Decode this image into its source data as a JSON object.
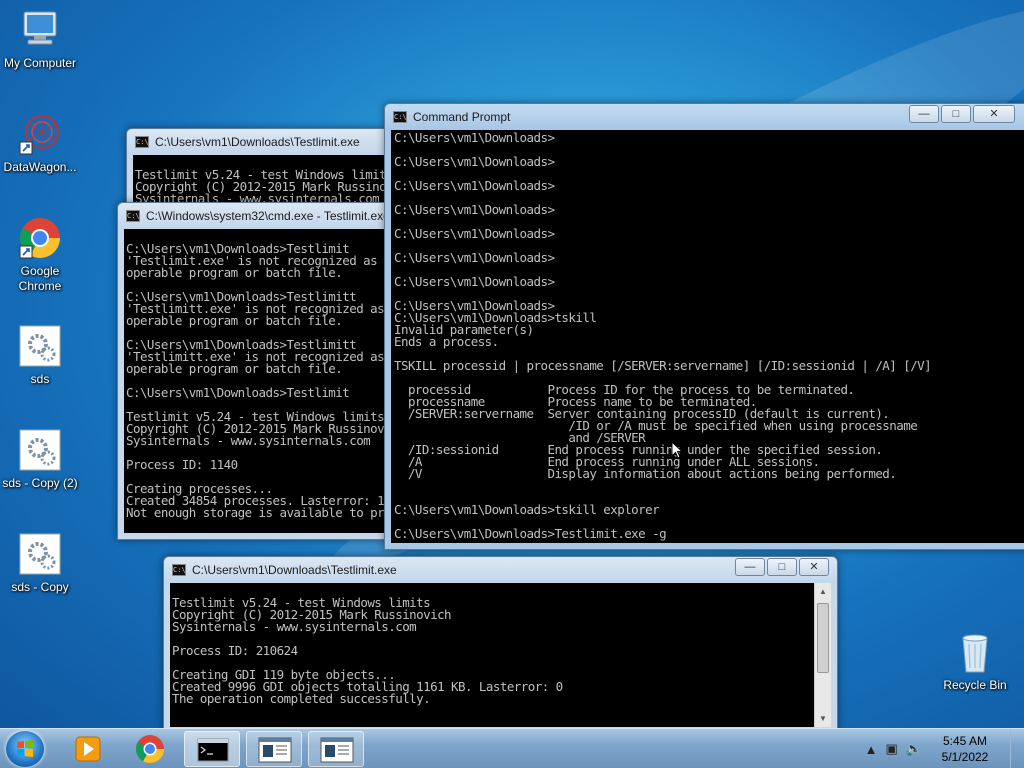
{
  "desktop_icons": [
    {
      "id": "my-computer",
      "label": "My Computer"
    },
    {
      "id": "datawagon",
      "label": "DataWagon..."
    },
    {
      "id": "chrome",
      "label": "Google Chrome"
    },
    {
      "id": "sds",
      "label": "sds"
    },
    {
      "id": "sds-copy-2",
      "label": "sds - Copy (2)"
    },
    {
      "id": "sds-copy",
      "label": "sds - Copy"
    },
    {
      "id": "recycle",
      "label": "Recycle Bin"
    }
  ],
  "windows": {
    "testlimit_back": {
      "title": "C:\\Users\\vm1\\Downloads\\Testlimit.exe",
      "content": "\nTestlimit v5.24 - test Windows limits\nCopyright (C) 2012-2015 Mark Russinovich\nSysinternals - www.sysinternals.com"
    },
    "cmd_testlimit": {
      "title": "C:\\Windows\\system32\\cmd.exe - Testlimit.exe",
      "content": "\nC:\\Users\\vm1\\Downloads>Testlimit\n'Testlimit.exe' is not recognized as an internal or external command,\noperable program or batch file.\n\nC:\\Users\\vm1\\Downloads>Testlimitt\n'Testlimitt.exe' is not recognized as an internal or external command,\noperable program or batch file.\n\nC:\\Users\\vm1\\Downloads>Testlimitt\n'Testlimitt.exe' is not recognized as an internal or external command,\noperable program or batch file.\n\nC:\\Users\\vm1\\Downloads>Testlimit\n\nTestlimit v5.24 - test Windows limits\nCopyright (C) 2012-2015 Mark Russinovich\nSysinternals - www.sysinternals.com\n\nProcess ID: 1140\n\nCreating processes...\nCreated 34854 processes. Lasterror: 1455\nNot enough storage is available to process this command."
    },
    "command_prompt": {
      "title": "Command Prompt",
      "content": "C:\\Users\\vm1\\Downloads>\n\nC:\\Users\\vm1\\Downloads>\n\nC:\\Users\\vm1\\Downloads>\n\nC:\\Users\\vm1\\Downloads>\n\nC:\\Users\\vm1\\Downloads>\n\nC:\\Users\\vm1\\Downloads>\n\nC:\\Users\\vm1\\Downloads>\n\nC:\\Users\\vm1\\Downloads>\nC:\\Users\\vm1\\Downloads>tskill\nInvalid parameter(s)\nEnds a process.\n\nTSKILL processid | processname [/SERVER:servername] [/ID:sessionid | /A] [/V]\n\n  processid           Process ID for the process to be terminated.\n  processname         Process name to be terminated.\n  /SERVER:servername  Server containing processID (default is current).\n                         /ID or /A must be specified when using processname\n                         and /SERVER\n  /ID:sessionid       End process running under the specified session.\n  /A                  End process running under ALL sessions.\n  /V                  Display information about actions being performed.\n\n\nC:\\Users\\vm1\\Downloads>tskill explorer\n\nC:\\Users\\vm1\\Downloads>Testlimit.exe -g"
    },
    "testlimit_front": {
      "title": "C:\\Users\\vm1\\Downloads\\Testlimit.exe",
      "content": "\nTestlimit v5.24 - test Windows limits\nCopyright (C) 2012-2015 Mark Russinovich\nSysinternals - www.sysinternals.com\n\nProcess ID: 210624\n\nCreating GDI 119 byte objects...\nCreated 9996 GDI objects totalling 1161 KB. Lasterror: 0\nThe operation completed successfully."
    }
  },
  "taskbar": {
    "time": "5:45 AM",
    "date": "5/1/2022",
    "buttons": [
      "start-button",
      "media-player",
      "chrome",
      "command-prompt",
      "testlimit-1",
      "testlimit-2"
    ]
  },
  "colors": {
    "console_bg": "#000000",
    "console_fg": "#c0c0c0",
    "desktop": "#1f7fc9"
  }
}
